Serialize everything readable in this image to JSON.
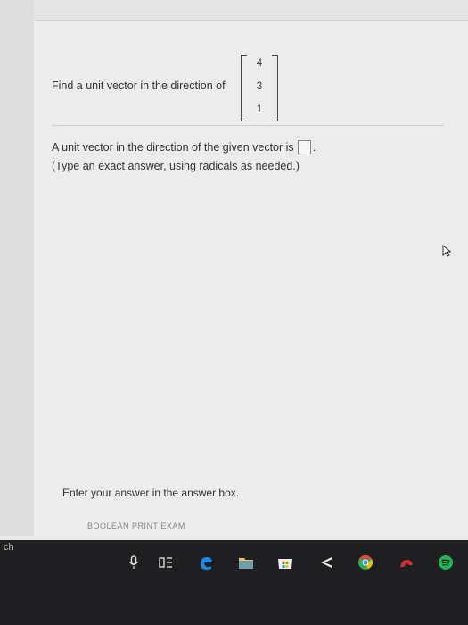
{
  "question": {
    "prompt": "Find a unit vector in the direction of",
    "vector": [
      "4",
      "3",
      "1"
    ]
  },
  "answer": {
    "label": "A unit vector in the direction of the given vector is",
    "period": ".",
    "hint": "(Type an exact answer, using radicals as needed.)"
  },
  "footer": {
    "instruction": "Enter your answer in the answer box.",
    "links": "BOOLEAN          PRINT EXAM"
  },
  "taskbar": {
    "search_fragment": "ch"
  },
  "colors": {
    "page_bg": "#ececec",
    "taskbar_bg": "#1f1f22",
    "edge_blue": "#1e88e5",
    "chrome_green": "#34a853",
    "spotify_green": "#1db954"
  }
}
